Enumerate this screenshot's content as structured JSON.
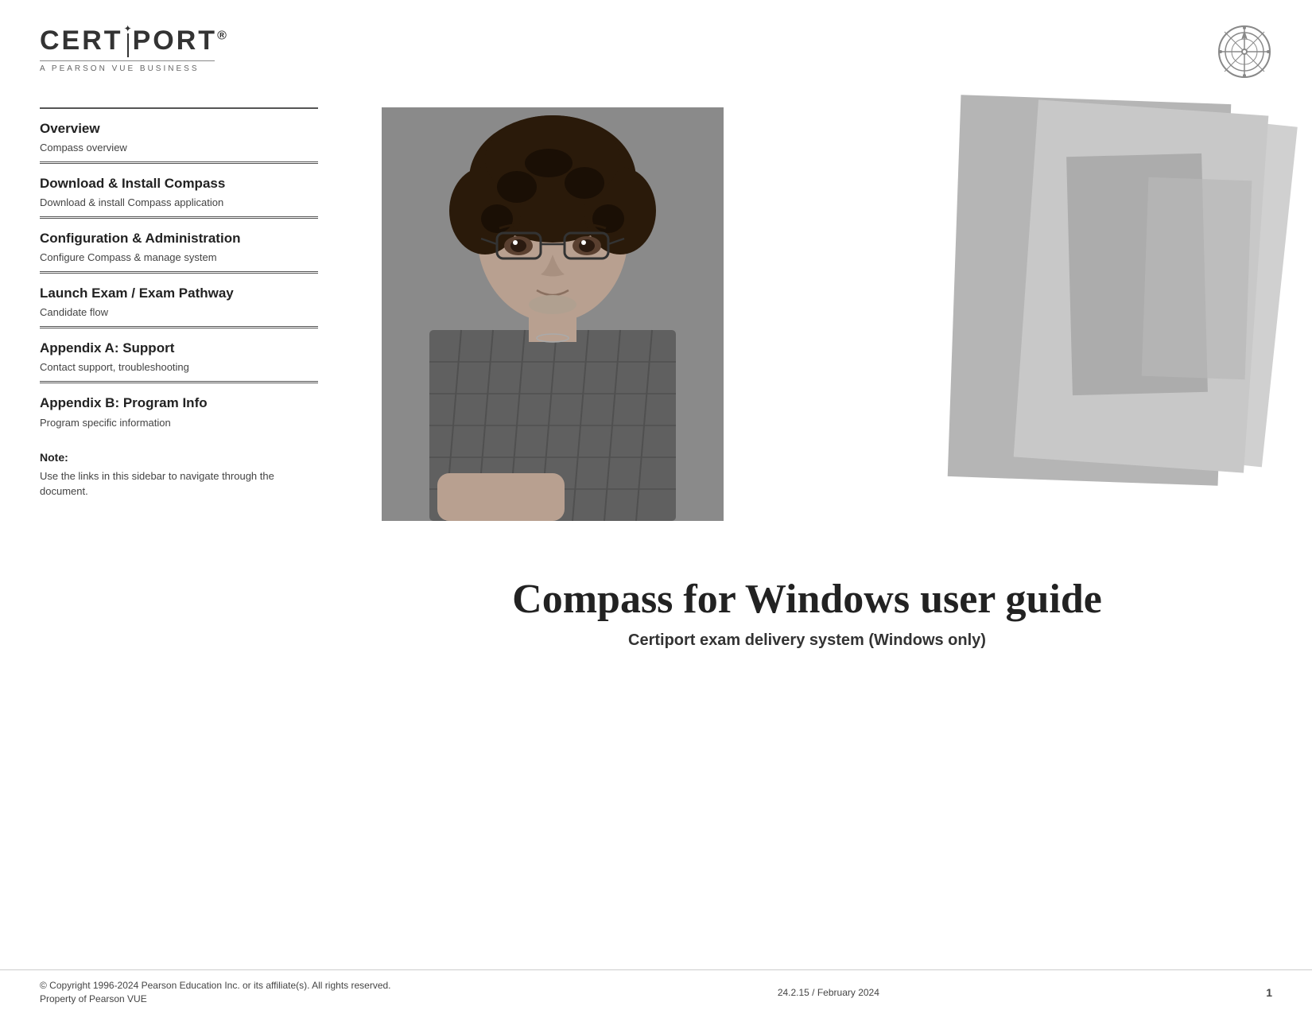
{
  "header": {
    "logo": {
      "part1": "CERT",
      "divider": "|",
      "part2": "PORT",
      "registered": "®",
      "subtitle": "A PEARSON VUE BUSINESS"
    },
    "compass_icon": "⊕"
  },
  "sidebar": {
    "items": [
      {
        "id": "overview",
        "title": "Overview",
        "description": "Compass overview"
      },
      {
        "id": "download",
        "title": "Download & Install Compass",
        "description": "Download & install Compass application"
      },
      {
        "id": "configuration",
        "title": "Configuration & Administration",
        "description": "Configure Compass & manage system"
      },
      {
        "id": "launch-exam",
        "title": "Launch Exam / Exam Pathway",
        "description": "Candidate flow"
      },
      {
        "id": "appendix-a",
        "title": "Appendix A: Support",
        "description": "Contact support, troubleshooting"
      },
      {
        "id": "appendix-b",
        "title": "Appendix B: Program Info",
        "description": "Program specific information"
      }
    ],
    "note": {
      "title": "Note:",
      "text": "Use the links in this sidebar to navigate through the document."
    }
  },
  "main": {
    "title": "Compass for Windows user guide",
    "subtitle": "Certiport exam delivery system (Windows only)"
  },
  "footer": {
    "copyright": "© Copyright 1996-2024 Pearson Education Inc. or its affiliate(s). All rights reserved.",
    "property": "Property of Pearson VUE",
    "version": "24.2.15 / February 2024",
    "page_number": "1"
  }
}
